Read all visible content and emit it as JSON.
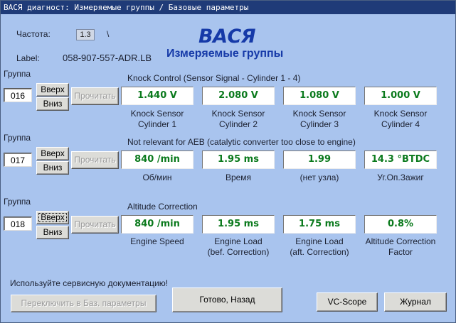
{
  "window": {
    "title": "ВАСЯ диагност: Измеряемые группы / Базовые параметры"
  },
  "header": {
    "freq_label": "Частота:",
    "freq_value": "1.3",
    "freq_suffix": "\\",
    "label_label": "Label:",
    "label_value": "058-907-557-ADR.LB",
    "brand": "ВАСЯ",
    "subtitle": "Измеряемые группы"
  },
  "groups": [
    {
      "label": "Группа",
      "number": "016",
      "up": "Вверх",
      "down": "Вниз",
      "read": "Прочитать",
      "title": "Knock Control (Sensor Signal - Cylinder 1 - 4)",
      "fields": [
        {
          "value": "1.440 V",
          "cap1": "Knock Sensor",
          "cap2": "Cylinder 1"
        },
        {
          "value": "2.080 V",
          "cap1": "Knock Sensor",
          "cap2": "Cylinder 2"
        },
        {
          "value": "1.080 V",
          "cap1": "Knock Sensor",
          "cap2": "Cylinder 3"
        },
        {
          "value": "1.000 V",
          "cap1": "Knock Sensor",
          "cap2": "Cylinder 4"
        }
      ]
    },
    {
      "label": "Группа",
      "number": "017",
      "up": "Вверх",
      "down": "Вниз",
      "read": "Прочитать",
      "title": "Not relevant for AEB (catalytic converter too close to engine)",
      "fields": [
        {
          "value": "840 /min",
          "cap1": "Об/мин",
          "cap2": ""
        },
        {
          "value": "1.95 ms",
          "cap1": "Время",
          "cap2": ""
        },
        {
          "value": "1.99",
          "cap1": "(нет узла)",
          "cap2": ""
        },
        {
          "value": "14.3 °BTDC",
          "cap1": "Уг.Оп.Зажиг",
          "cap2": ""
        }
      ]
    },
    {
      "label": "Группа",
      "number": "018",
      "up": "Вверх",
      "down": "Вниз",
      "read": "Прочитать",
      "title": "Altitude Correction",
      "fields": [
        {
          "value": "840 /min",
          "cap1": "Engine Speed",
          "cap2": ""
        },
        {
          "value": "1.95 ms",
          "cap1": "Engine Load",
          "cap2": "(bef. Correction)"
        },
        {
          "value": "1.75 ms",
          "cap1": "Engine Load",
          "cap2": "(aft. Correction)"
        },
        {
          "value": "0.8%",
          "cap1": "Altitude Correction",
          "cap2": "Factor"
        }
      ]
    }
  ],
  "footer": {
    "hint": "Используйте сервисную документацию!",
    "switch_button": "Переключить в Баз. параметры",
    "done_button": "Готово, Назад",
    "vcscope_button": "VC-Scope",
    "journal_button": "Журнал"
  },
  "colors": {
    "background": "#a9c4ee",
    "value_text": "#0b7a1d",
    "brand": "#163aa8",
    "titlebar": "#1f3b78"
  }
}
